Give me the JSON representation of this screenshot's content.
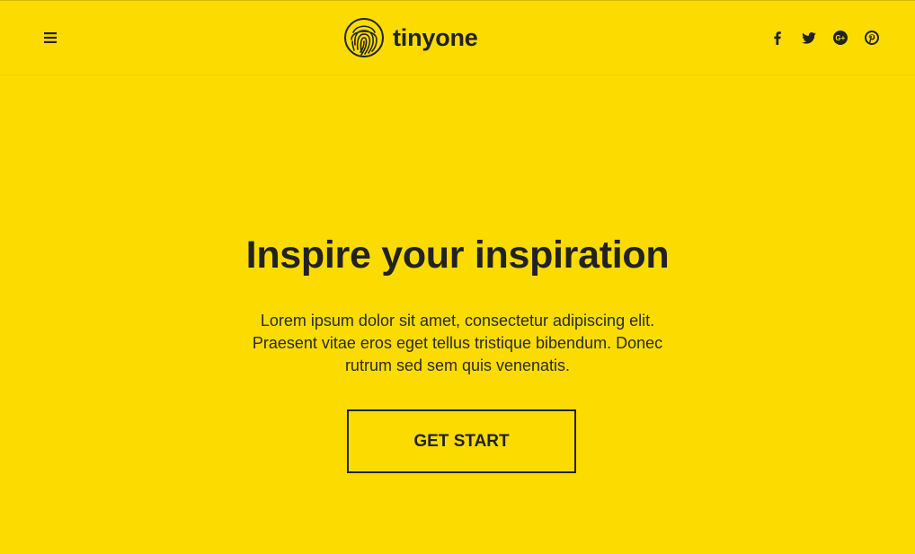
{
  "colors": {
    "background": "#FCDC00",
    "text": "#222222"
  },
  "header": {
    "menu_icon": "hamburger-menu-icon",
    "logo_icon": "fingerprint-icon",
    "brand_name": "tinyone",
    "social": [
      {
        "name": "facebook",
        "icon": "facebook-icon"
      },
      {
        "name": "twitter",
        "icon": "twitter-icon"
      },
      {
        "name": "google-plus",
        "icon": "google-plus-icon"
      },
      {
        "name": "pinterest",
        "icon": "pinterest-icon"
      }
    ]
  },
  "hero": {
    "title": "Inspire your inspiration",
    "description": "Lorem ipsum dolor sit amet, consectetur adipiscing elit. Praesent vitae eros eget tellus tristique bibendum. Donec rutrum sed sem quis venenatis.",
    "cta_label": "GET START"
  }
}
